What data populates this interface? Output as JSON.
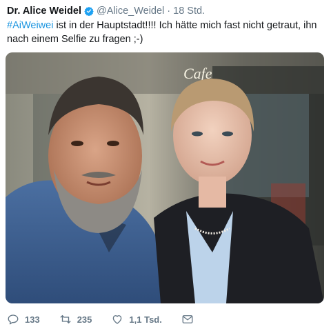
{
  "tweet": {
    "author_name": "Dr. Alice Weidel",
    "verified_icon": "verified-badge-icon",
    "handle": "@Alice_Weidel",
    "separator": "·",
    "timestamp": "18 Std.",
    "hashtag": "#AiWeiwei",
    "text": "ist in der Hauptstadt!!!! Ich hätte mich fast nicht getraut, ihn nach einem Selfie zu fragen ;-)",
    "photo_sign": "Cafe"
  },
  "actions": {
    "reply_count": "133",
    "retweet_count": "235",
    "like_count": "1,1 Tsd.",
    "icons": [
      "reply-icon",
      "retweet-icon",
      "like-icon",
      "message-icon"
    ]
  },
  "colors": {
    "hashtag": "#1b95e0",
    "secondary_text": "#657786",
    "verified": "#1da1f2"
  }
}
